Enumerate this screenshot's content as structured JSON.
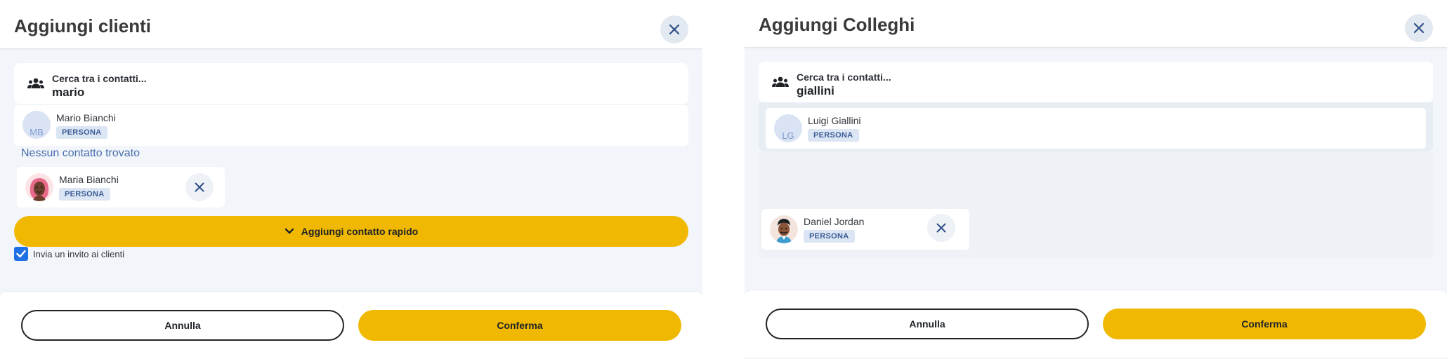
{
  "left_panel": {
    "title": "Aggiungi clienti",
    "search": {
      "label": "Cerca tra i contatti...",
      "value": "mario"
    },
    "results": [
      {
        "initials": "MB",
        "name": "Mario Bianchi",
        "tag": "PERSONA"
      }
    ],
    "empty_message": "Nessun contatto trovato",
    "selected": [
      {
        "name": "Maria Bianchi",
        "tag": "PERSONA"
      }
    ],
    "quick_add_label": "Aggiungi contatto rapido",
    "invite_label": "Invia un invito ai clienti",
    "invite_checked": true,
    "cancel_label": "Annulla",
    "confirm_label": "Conferma"
  },
  "right_panel": {
    "title": "Aggiungi Colleghi",
    "search": {
      "label": "Cerca tra i contatti...",
      "value": "giallini"
    },
    "results": [
      {
        "initials": "LG",
        "name": "Luigi Giallini",
        "tag": "PERSONA"
      }
    ],
    "selected": [
      {
        "name": "Daniel Jordan",
        "tag": "PERSONA"
      }
    ],
    "cancel_label": "Annulla",
    "confirm_label": "Conferma"
  },
  "icons": {
    "close": "close-icon",
    "group": "group-icon",
    "chevron": "chevron-down-icon",
    "check": "checkmark-icon"
  },
  "colors": {
    "accent": "#f0b800",
    "panel_bg": "#f2f5f9",
    "tag_bg": "#dce5f3",
    "tag_text": "#3a5d96",
    "link_text": "#4a6fae",
    "checkbox": "#1f6fe5"
  }
}
